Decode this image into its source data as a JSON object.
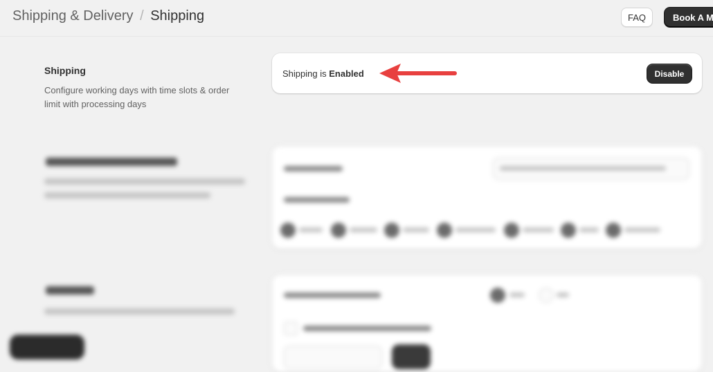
{
  "header": {
    "breadcrumb_parent": "Shipping & Delivery",
    "breadcrumb_separator": "/",
    "breadcrumb_current": "Shipping",
    "faq_label": "FAQ",
    "book_label": "Book A Meeting"
  },
  "shipping_section": {
    "title": "Shipping",
    "description": "Configure working days with time slots & order limit with processing days",
    "status_prefix": "Shipping is",
    "status_value": "Enabled",
    "disable_label": "Disable"
  },
  "annotation": {
    "arrow_color": "#e8403f"
  },
  "colors": {
    "background": "#f1f1f1",
    "primary_button": "#303030"
  }
}
